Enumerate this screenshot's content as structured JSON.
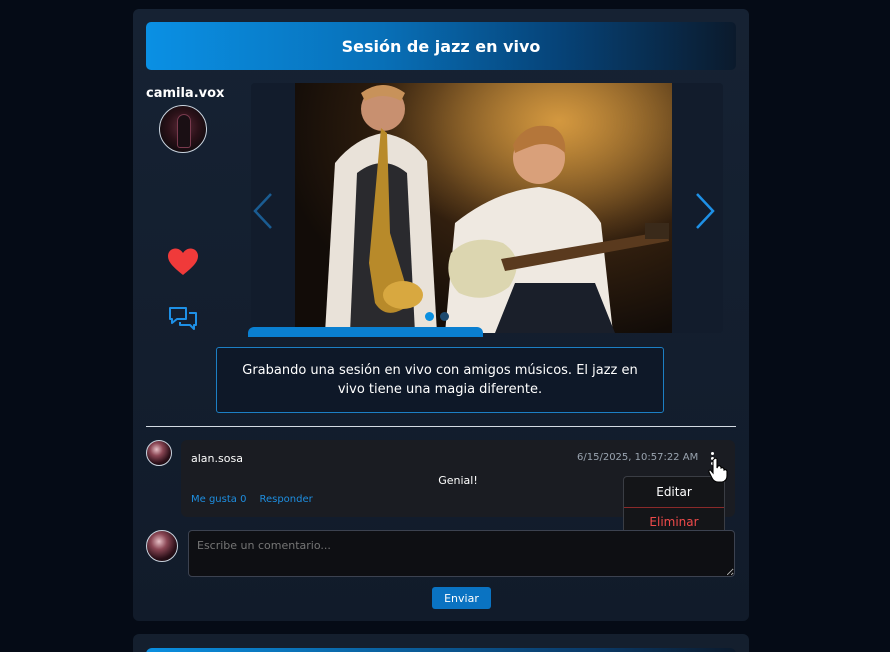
{
  "post": {
    "title": "Sesión de jazz en vivo",
    "author": "camila.vox",
    "description": "Grabando una sesión en vivo con amigos músicos. El jazz en vivo tiene una magia diferente.",
    "carousel": {
      "total_slides": 2,
      "active_slide": 1
    },
    "icons": {
      "like": "heart-icon",
      "comments": "chat-bubbles-icon",
      "prev": "chevron-left-icon",
      "next": "chevron-right-icon"
    }
  },
  "comments": [
    {
      "user": "alan.sosa",
      "date": "6/15/2025, 10:57:22 AM",
      "text": "Genial!",
      "like_label": "Me gusta 0",
      "reply_label": "Responder"
    }
  ],
  "comment_menu": {
    "edit": "Editar",
    "delete": "Eliminar"
  },
  "new_comment": {
    "placeholder": "Escribe un comentario...",
    "send_label": "Enviar"
  },
  "colors": {
    "accent": "#0a8fe0",
    "like": "#f03a3a",
    "delete": "#ef4a4a"
  }
}
